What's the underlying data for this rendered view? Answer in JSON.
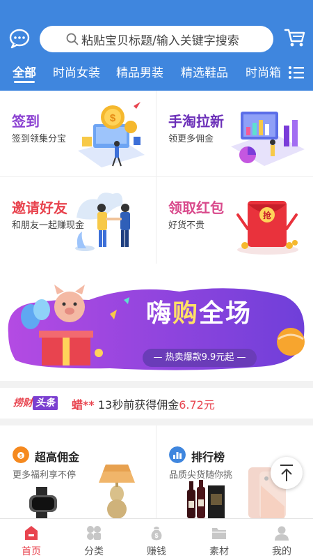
{
  "header": {
    "search_placeholder": "粘贴宝贝标题/输入关键字搜索",
    "tabs": [
      "全部",
      "时尚女装",
      "精品男装",
      "精选鞋品",
      "时尚箱"
    ]
  },
  "features": [
    {
      "title": "签到",
      "subtitle": "签到领集分宝",
      "color": "#8a3fd1"
    },
    {
      "title": "手淘拉新",
      "subtitle": "领更多佣金",
      "color": "#6b2fb8"
    },
    {
      "title": "邀请好友",
      "subtitle": "和朋友一起赚现金",
      "color": "#e8444f"
    },
    {
      "title": "领取红包",
      "subtitle": "好货不贵",
      "color": "#d94a8c"
    }
  ],
  "banner": {
    "title_a": "嗨",
    "title_b": "购",
    "title_c": "全场",
    "pill": "— 热卖爆款9.9元起 —"
  },
  "ticker": {
    "logo_a": "捞财",
    "logo_b": "头条",
    "name": "蜡**",
    "text": " 13秒前获得佣金",
    "amount": "6.72元"
  },
  "cards": [
    {
      "title": "超高佣金",
      "subtitle": "更多福利享不停",
      "icon": "money-bag-icon"
    },
    {
      "title": "排行榜",
      "subtitle": "品质尖货随你挑",
      "icon": "bar-chart-icon"
    }
  ],
  "bottom_nav": [
    {
      "label": "首页",
      "icon": "home-icon",
      "active": true
    },
    {
      "label": "分类",
      "icon": "category-icon",
      "active": false
    },
    {
      "label": "赚钱",
      "icon": "money-icon",
      "active": false
    },
    {
      "label": "素材",
      "icon": "folder-icon",
      "active": false
    },
    {
      "label": "我的",
      "icon": "user-icon",
      "active": false
    }
  ],
  "colors": {
    "primary": "#3f86de",
    "accent": "#e8444f",
    "purple": "#7b3fd0"
  }
}
